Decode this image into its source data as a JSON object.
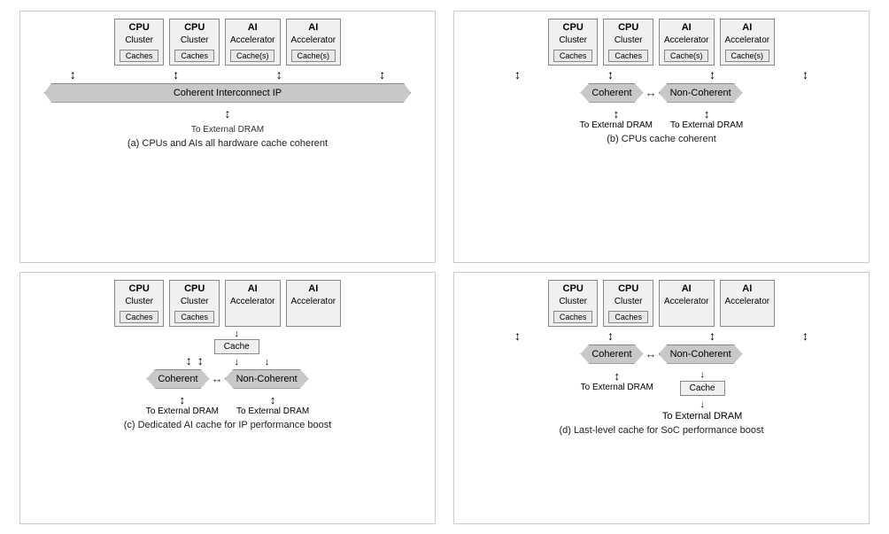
{
  "diagrams": [
    {
      "id": "a",
      "caption": "(a) CPUs and AIs all hardware cache coherent",
      "units": [
        {
          "title": "CPU",
          "sub": "Cluster",
          "cache": "Caches"
        },
        {
          "title": "CPU",
          "sub": "Cluster",
          "cache": "Caches"
        },
        {
          "title": "AI",
          "sub": "Accelerator",
          "cache": "Cache(s)"
        },
        {
          "title": "AI",
          "sub": "Accelerator",
          "cache": "Cache(s)"
        }
      ],
      "type": "single-banner",
      "banner": "Coherent Interconnect IP",
      "dram": [
        "To External DRAM"
      ]
    },
    {
      "id": "b",
      "caption": "(b) CPUs cache coherent",
      "units": [
        {
          "title": "CPU",
          "sub": "Cluster",
          "cache": "Caches"
        },
        {
          "title": "CPU",
          "sub": "Cluster",
          "cache": "Caches"
        },
        {
          "title": "AI",
          "sub": "Accelerator",
          "cache": "Cache(s)"
        },
        {
          "title": "AI",
          "sub": "Accelerator",
          "cache": "Cache(s)"
        }
      ],
      "type": "dual-banner",
      "banner1": "Coherent",
      "banner2": "Non-Coherent",
      "dram": [
        "To External DRAM",
        "To External DRAM"
      ]
    },
    {
      "id": "c",
      "caption": "(c) Dedicated AI cache for IP performance boost",
      "units": [
        {
          "title": "CPU",
          "sub": "Cluster",
          "cache": "Caches"
        },
        {
          "title": "CPU",
          "sub": "Cluster",
          "cache": "Caches"
        },
        {
          "title": "AI",
          "sub": "Accelerator",
          "cache": null
        },
        {
          "title": "AI",
          "sub": "Accelerator",
          "cache": null
        }
      ],
      "type": "dual-banner-midcache",
      "banner1": "Coherent",
      "banner2": "Non-Coherent",
      "midcache": "Cache",
      "dram": [
        "To External DRAM",
        "To External DRAM"
      ]
    },
    {
      "id": "d",
      "caption": "(d) Last-level cache for SoC performance boost",
      "units": [
        {
          "title": "CPU",
          "sub": "Cluster",
          "cache": "Caches"
        },
        {
          "title": "CPU",
          "sub": "Cluster",
          "cache": "Caches"
        },
        {
          "title": "AI",
          "sub": "Accelerator",
          "cache": null
        },
        {
          "title": "AI",
          "sub": "Accelerator",
          "cache": null
        }
      ],
      "type": "dual-banner-bottomcache",
      "banner1": "Coherent",
      "banner2": "Non-Coherent",
      "bottomcache": "Cache",
      "dram": [
        "To External DRAM",
        "To External DRAM"
      ]
    }
  ]
}
